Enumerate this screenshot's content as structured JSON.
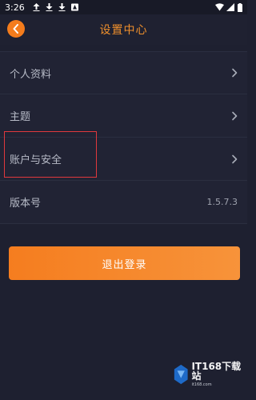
{
  "status_bar": {
    "time": "3:26"
  },
  "header": {
    "title": "设置中心"
  },
  "menu": {
    "items": [
      {
        "label": "个人资料"
      },
      {
        "label": "主题"
      },
      {
        "label": "账户与安全"
      },
      {
        "label": "版本号",
        "value": "1.5.7.3"
      }
    ]
  },
  "logout_label": "退出登录",
  "watermark": {
    "text": "IT168下载站",
    "sub": "it168.com"
  },
  "colors": {
    "accent": "#f47c1c",
    "background": "#1e2030",
    "highlight": "#e0383d"
  }
}
